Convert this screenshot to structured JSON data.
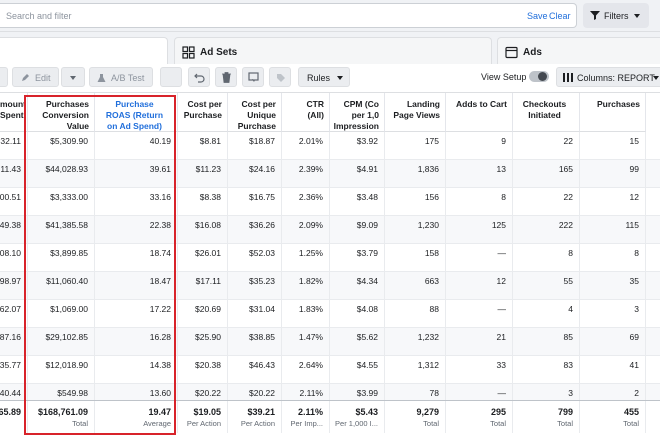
{
  "search": {
    "placeholder": "Search and filter",
    "save": "Save",
    "clear": "Clear",
    "filters": "Filters"
  },
  "tabs": {
    "ad_sets": "Ad Sets",
    "ads": "Ads"
  },
  "toolbar": {
    "edit": "Edit",
    "ab_test": "A/B Test",
    "rules": "Rules",
    "view_setup": "View Setup",
    "columns": "Columns: REPORT"
  },
  "columns": [
    "mount\nSpent",
    "Purchases\nConversion\nValue",
    "Purchase\nROAS (Return\non Ad Spend)",
    "Cost per\nPurchase",
    "Cost per\nUnique\nPurchase",
    "CTR\n(All)",
    "CPM (Co\nper 1,0\nImpression",
    "Landing\nPage Views",
    "Adds to Cart",
    "Checkouts\nInitiated",
    "Purchases"
  ],
  "rows": [
    [
      "32.11",
      "$5,309.90",
      "40.19",
      "$8.81",
      "$18.87",
      "2.01%",
      "$3.92",
      "175",
      "9",
      "22",
      "15"
    ],
    [
      "11.43",
      "$44,028.93",
      "39.61",
      "$11.23",
      "$24.16",
      "2.39%",
      "$4.91",
      "1,836",
      "13",
      "165",
      "99"
    ],
    [
      "00.51",
      "$3,333.00",
      "33.16",
      "$8.38",
      "$16.75",
      "2.36%",
      "$3.48",
      "156",
      "8",
      "22",
      "12"
    ],
    [
      "49.38",
      "$41,385.58",
      "22.38",
      "$16.08",
      "$36.26",
      "2.09%",
      "$9.09",
      "1,230",
      "125",
      "222",
      "115"
    ],
    [
      "08.10",
      "$3,899.85",
      "18.74",
      "$26.01",
      "$52.03",
      "1.25%",
      "$3.79",
      "158",
      "—",
      "8",
      "8"
    ],
    [
      "98.97",
      "$11,060.40",
      "18.47",
      "$17.11",
      "$35.23",
      "1.82%",
      "$4.34",
      "663",
      "12",
      "55",
      "35"
    ],
    [
      "62.07",
      "$1,069.00",
      "17.22",
      "$20.69",
      "$31.04",
      "1.83%",
      "$4.08",
      "88",
      "—",
      "4",
      "3"
    ],
    [
      "87.16",
      "$29,102.85",
      "16.28",
      "$25.90",
      "$38.85",
      "1.47%",
      "$5.62",
      "1,232",
      "21",
      "85",
      "69"
    ],
    [
      "35.77",
      "$12,018.90",
      "14.38",
      "$20.38",
      "$46.43",
      "2.64%",
      "$4.55",
      "1,312",
      "33",
      "83",
      "41"
    ],
    [
      "40.44",
      "$549.98",
      "13.60",
      "$20.22",
      "$20.22",
      "2.11%",
      "$3.99",
      "78",
      "—",
      "3",
      "2"
    ]
  ],
  "totals": [
    {
      "value": "65.89",
      "sub": ""
    },
    {
      "value": "$168,761.09",
      "sub": "Total"
    },
    {
      "value": "19.47",
      "sub": "Average"
    },
    {
      "value": "$19.05",
      "sub": "Per Action"
    },
    {
      "value": "$39.21",
      "sub": "Per Action"
    },
    {
      "value": "2.11%",
      "sub": "Per Imp..."
    },
    {
      "value": "$5.43",
      "sub": "Per 1,000 I..."
    },
    {
      "value": "9,279",
      "sub": "Total"
    },
    {
      "value": "295",
      "sub": "Total"
    },
    {
      "value": "799",
      "sub": "Total"
    },
    {
      "value": "455",
      "sub": "Total"
    }
  ],
  "colors": {
    "accent": "#216fdb",
    "highlight_border": "#d8232a"
  }
}
